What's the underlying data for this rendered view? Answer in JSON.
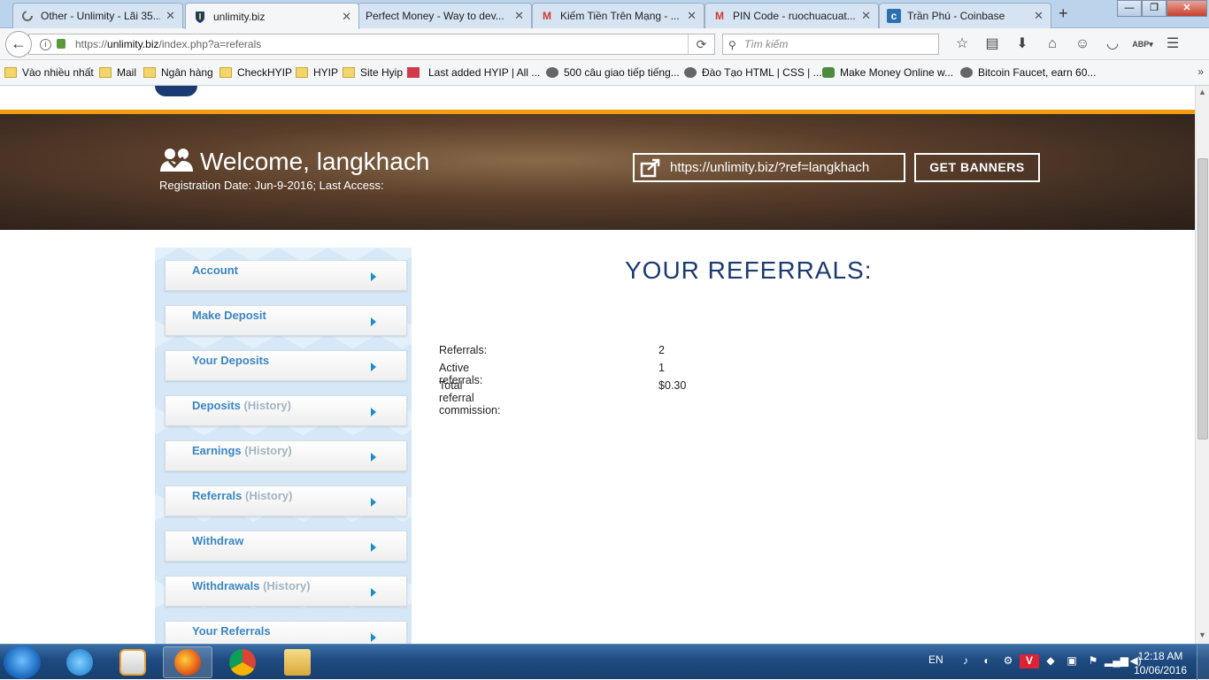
{
  "browser": {
    "tabs": [
      {
        "title": "Other - Unlimity - Lãi 35...",
        "icon": "loading-icon"
      },
      {
        "title": "unlimity.biz",
        "icon": "unlimity-favicon",
        "active": true
      },
      {
        "title": "Perfect Money - Way to dev...",
        "icon": "none"
      },
      {
        "title": "Kiếm Tiền Trên Mạng - ...",
        "icon": "gmail-icon"
      },
      {
        "title": "PIN Code - ruochuacuat...",
        "icon": "gmail-icon"
      },
      {
        "title": "Trần Phú - Coinbase",
        "icon": "coinbase-icon"
      }
    ],
    "new_tab": "+",
    "url_scheme": "https://",
    "url_host": "unlimity.biz",
    "url_path": "/index.php?a=referals",
    "search_placeholder": "Tìm kiếm",
    "bookmarks": [
      {
        "label": "Vào nhiều nhất",
        "icon": "star-folder-icon"
      },
      {
        "label": "Mail",
        "icon": "folder-icon"
      },
      {
        "label": "Ngân hàng",
        "icon": "folder-icon"
      },
      {
        "label": "CheckHYIP",
        "icon": "folder-icon"
      },
      {
        "label": "HYIP",
        "icon": "folder-icon"
      },
      {
        "label": "Site Hyip",
        "icon": "folder-icon"
      },
      {
        "label": "Last added HYIP | All ...",
        "icon": "allhyip-icon"
      },
      {
        "label": "500 câu giao tiếp tiếng...",
        "icon": "globe-icon"
      },
      {
        "label": "Đào Tạo HTML | CSS | ...",
        "icon": "globe-icon"
      },
      {
        "label": "Make Money Online w...",
        "icon": "globe-icon"
      },
      {
        "label": "Bitcoin Faucet, earn 60...",
        "icon": "globe-icon"
      }
    ]
  },
  "hero": {
    "welcome": "Welcome, langkhach",
    "registration": "Registration Date: Jun-9-2016; Last Access:",
    "ref_link": "https://unlimity.biz/?ref=langkhach",
    "get_banners": "GET BANNERS"
  },
  "sidebar": {
    "items": [
      {
        "label": "Account",
        "suffix": ""
      },
      {
        "label": "Make Deposit",
        "suffix": ""
      },
      {
        "label": "Your Deposits",
        "suffix": ""
      },
      {
        "label": "Deposits",
        "suffix": "(History)"
      },
      {
        "label": "Earnings",
        "suffix": "(History)"
      },
      {
        "label": "Referrals",
        "suffix": "(History)"
      },
      {
        "label": "Withdraw",
        "suffix": ""
      },
      {
        "label": "Withdrawals",
        "suffix": "(History)"
      },
      {
        "label": "Your Referrals",
        "suffix": ""
      }
    ]
  },
  "main": {
    "title": "YOUR REFERRALS:",
    "stats": [
      {
        "label": "Referrals:",
        "value": "2"
      },
      {
        "label": "Active referrals:",
        "value": "1"
      },
      {
        "label": "Total referral commission:",
        "value": "$0.30"
      }
    ]
  },
  "taskbar": {
    "lang": "EN",
    "time": "12:18 AM",
    "date": "10/06/2016",
    "apps": [
      "internet-explorer-icon",
      "media-player-icon",
      "firefox-icon",
      "chrome-icon",
      "file-explorer-icon"
    ]
  },
  "colors": {
    "accent_orange": "#f39c12",
    "title_navy": "#1c3a72",
    "menu_link": "#3a86c4",
    "menu_arrow": "#1a8dc8"
  }
}
